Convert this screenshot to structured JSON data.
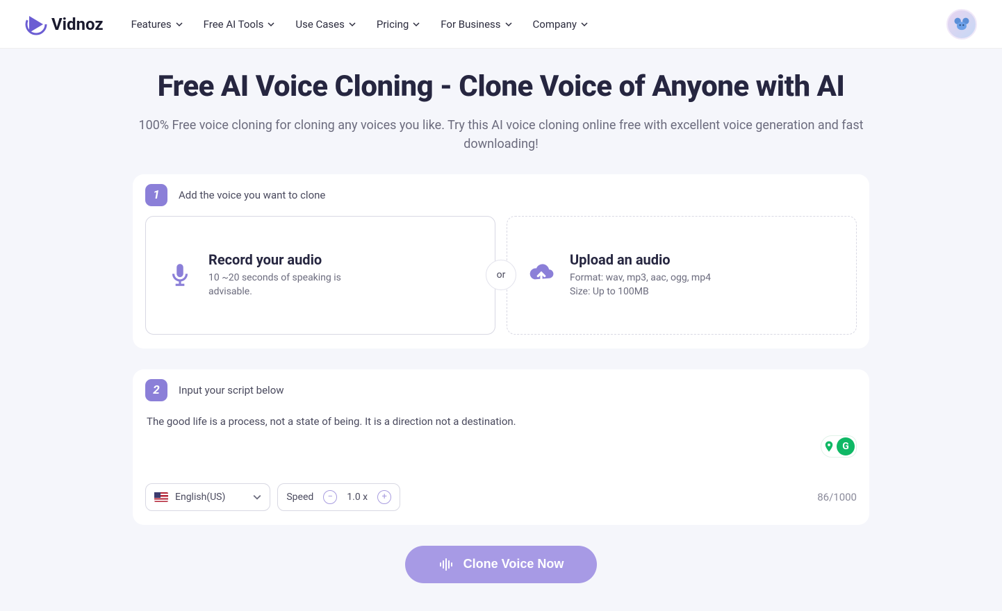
{
  "brand": "Vidnoz",
  "nav": {
    "items": [
      "Features",
      "Free AI Tools",
      "Use Cases",
      "Pricing",
      "For Business",
      "Company"
    ]
  },
  "hero": {
    "title": "Free AI Voice Cloning - Clone Voice of Anyone with AI",
    "subtitle": "100% Free voice cloning for cloning any voices you like. Try this AI voice cloning online free with excellent voice generation and fast downloading!"
  },
  "step1": {
    "num": "1",
    "label": "Add the voice you want to clone",
    "record": {
      "title": "Record your audio",
      "desc": "10 ~20 seconds of speaking is advisable."
    },
    "or": "or",
    "upload": {
      "title": "Upload an audio",
      "format": "Format: wav, mp3, aac, ogg, mp4",
      "size": "Size: Up to 100MB"
    }
  },
  "step2": {
    "num": "2",
    "label": "Input your script below",
    "text": "The good life is a process, not a state of being. It is a direction not a destination.",
    "language": "English(US)",
    "speed_label": "Speed",
    "speed_value": "1.0 x",
    "count": "86",
    "max": "/1000"
  },
  "cta": "Clone Voice Now"
}
